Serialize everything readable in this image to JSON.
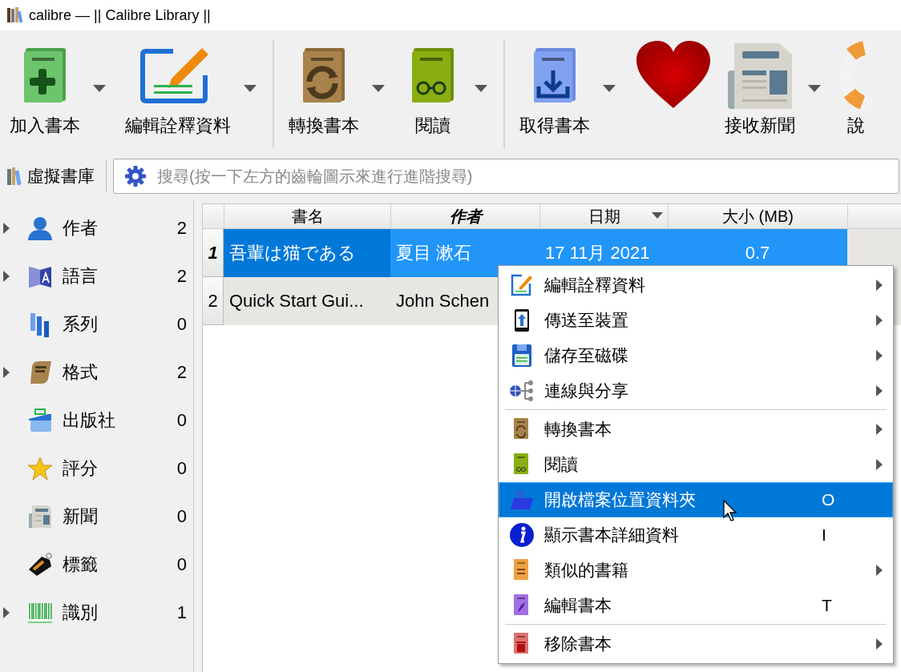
{
  "window": {
    "title": "calibre — || Calibre Library ||"
  },
  "toolbar": {
    "items": [
      {
        "kind": "button",
        "label": "加入書本",
        "has_menu": true
      },
      {
        "kind": "button",
        "label": "編輯詮釋資料",
        "has_menu": true
      },
      {
        "kind": "separator"
      },
      {
        "kind": "button",
        "label": "轉換書本",
        "has_menu": true
      },
      {
        "kind": "button",
        "label": "閱讀",
        "has_menu": true
      },
      {
        "kind": "separator"
      },
      {
        "kind": "button",
        "label": "取得書本",
        "has_menu": true
      },
      {
        "kind": "button",
        "has_menu": false
      },
      {
        "kind": "button",
        "label": "接收新聞",
        "has_menu": true
      },
      {
        "kind": "button",
        "label": "說",
        "has_menu": false
      }
    ]
  },
  "virtual_library": {
    "label": "虛擬書庫"
  },
  "search": {
    "placeholder": "搜尋(按一下左方的齒輪圖示來進行進階搜尋)"
  },
  "sidebar": {
    "items": [
      {
        "label": "作者",
        "count": "2",
        "expandable": true
      },
      {
        "label": "語言",
        "count": "2",
        "expandable": true
      },
      {
        "label": "系列",
        "count": "0",
        "expandable": false
      },
      {
        "label": "格式",
        "count": "2",
        "expandable": true
      },
      {
        "label": "出版社",
        "count": "0",
        "expandable": false
      },
      {
        "label": "評分",
        "count": "0",
        "expandable": false
      },
      {
        "label": "新聞",
        "count": "0",
        "expandable": false
      },
      {
        "label": "標籤",
        "count": "0",
        "expandable": false
      },
      {
        "label": "識別",
        "count": "1",
        "expandable": true
      }
    ]
  },
  "table": {
    "columns": [
      {
        "label": "書名",
        "emphasized": false,
        "sort_indicator": false
      },
      {
        "label": "作者",
        "emphasized": true,
        "sort_indicator": false
      },
      {
        "label": "日期",
        "emphasized": false,
        "sort_indicator": true
      },
      {
        "label": "大小 (MB)",
        "emphasized": false,
        "sort_indicator": false
      }
    ],
    "rows": [
      {
        "number": "1",
        "selected": true,
        "cells": [
          "吾輩は猫である",
          "夏目 漱石",
          "17 11月 2021",
          "0.7"
        ]
      },
      {
        "number": "2",
        "selected": false,
        "cells": [
          "Quick Start Gui...",
          "John Schen"
        ]
      }
    ]
  },
  "context_menu": {
    "items": [
      {
        "kind": "item",
        "label": "編輯詮釋資料",
        "submenu": true,
        "selected": false
      },
      {
        "kind": "item",
        "label": "傳送至裝置",
        "submenu": true,
        "selected": false
      },
      {
        "kind": "item",
        "label": "儲存至磁碟",
        "submenu": true,
        "selected": false
      },
      {
        "kind": "item",
        "label": "連線與分享",
        "submenu": true,
        "selected": false
      },
      {
        "kind": "separator"
      },
      {
        "kind": "item",
        "label": "轉換書本",
        "submenu": true,
        "selected": false
      },
      {
        "kind": "item",
        "label": "閱讀",
        "submenu": true,
        "selected": false
      },
      {
        "kind": "item",
        "label": "開啟檔案位置資料夾",
        "shortcut": "O",
        "submenu": false,
        "selected": true
      },
      {
        "kind": "item",
        "label": "顯示書本詳細資料",
        "shortcut": "I",
        "submenu": false,
        "selected": false
      },
      {
        "kind": "item",
        "label": "類似的書籍",
        "submenu": true,
        "selected": false
      },
      {
        "kind": "item",
        "label": "編輯書本",
        "shortcut": "T",
        "submenu": false,
        "selected": false
      },
      {
        "kind": "separator"
      },
      {
        "kind": "item",
        "label": "移除書本",
        "submenu": true,
        "selected": false
      }
    ]
  }
}
